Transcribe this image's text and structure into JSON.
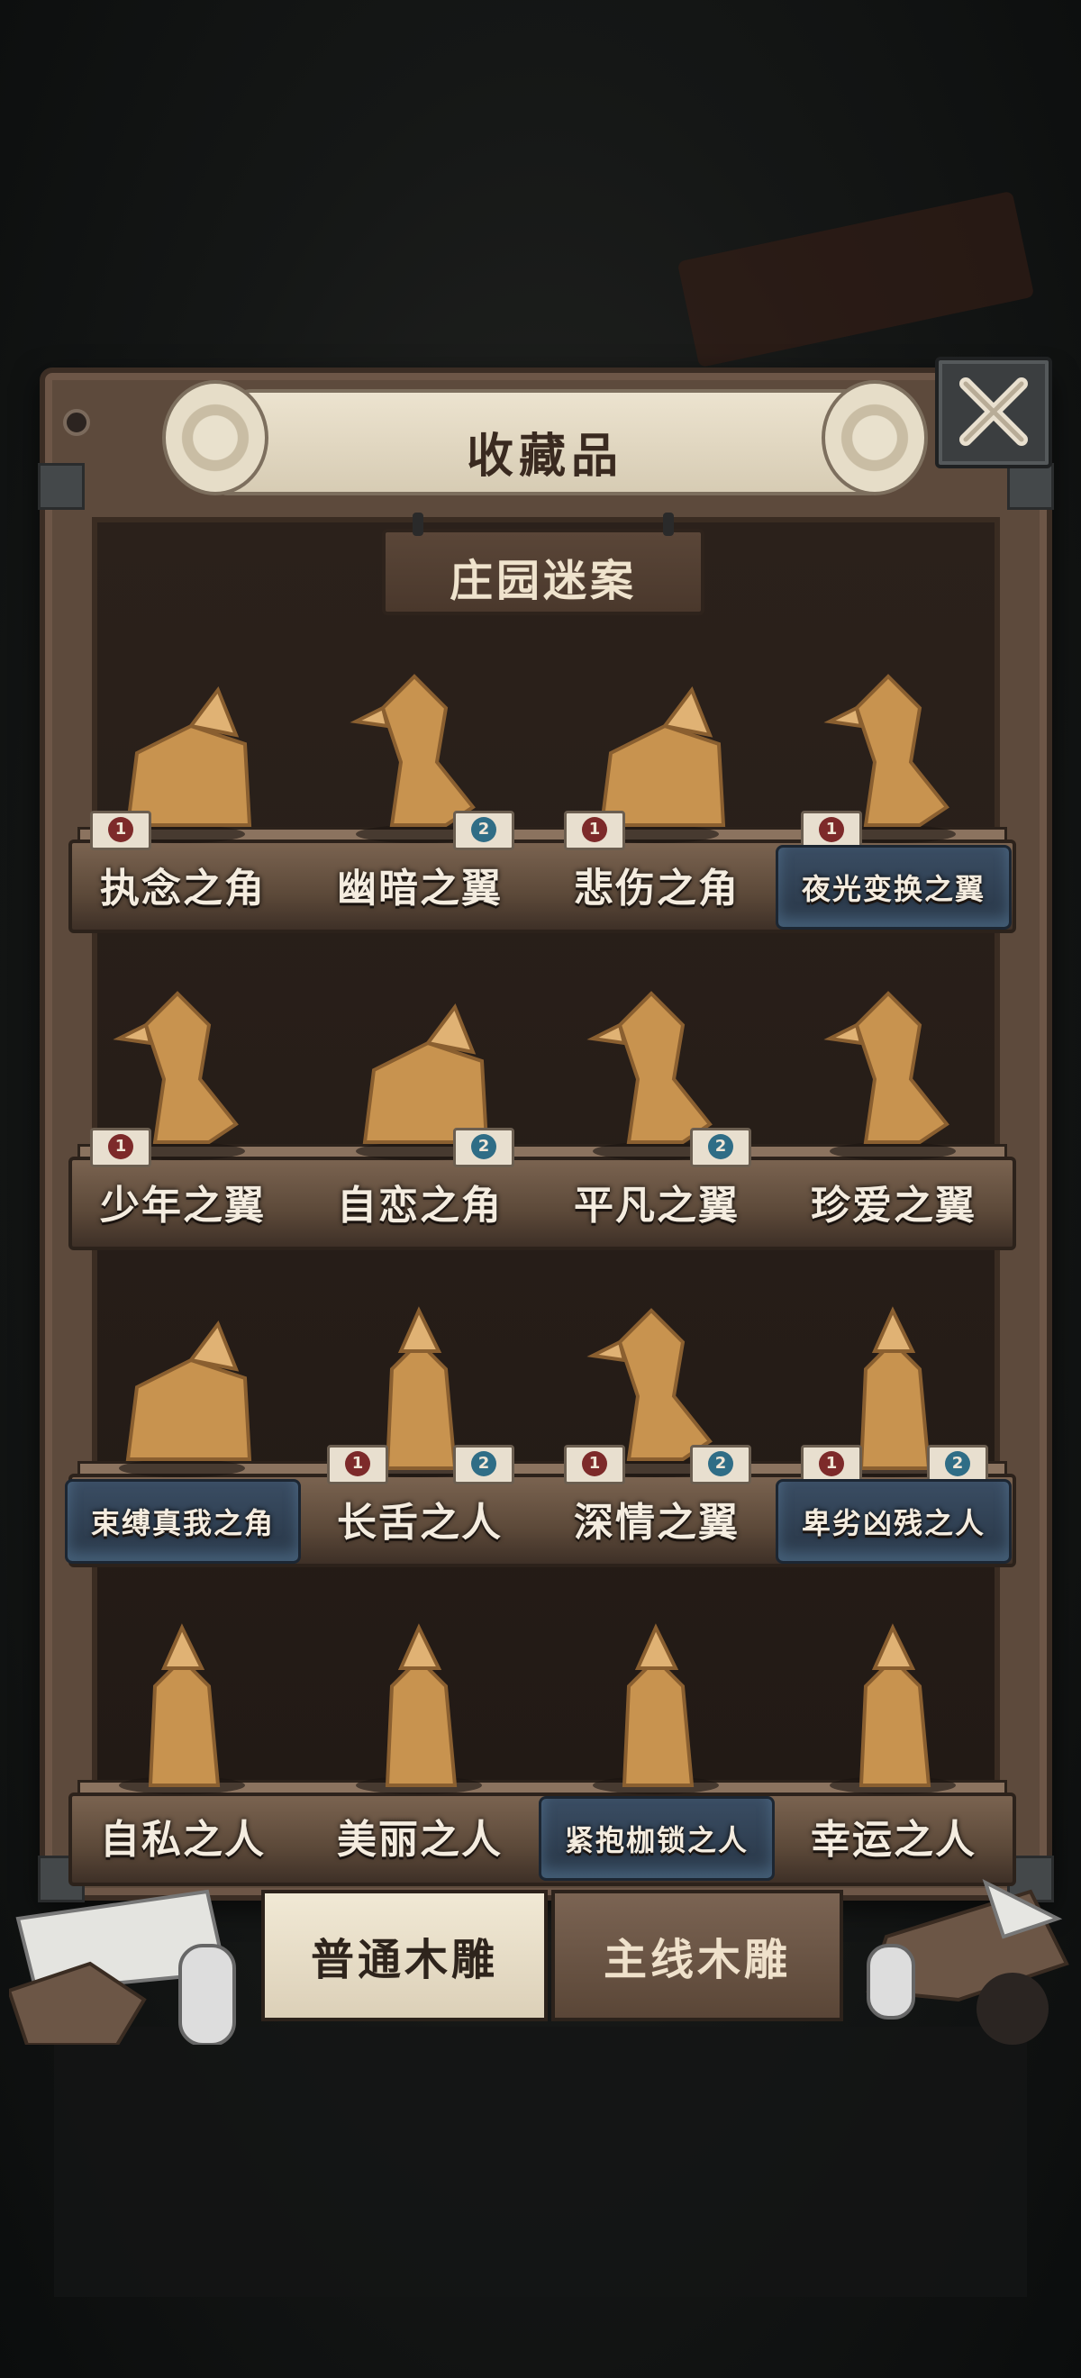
{
  "header": {
    "title": "收藏品",
    "close_icon": "close-x-icon"
  },
  "category": {
    "label": "庄园迷案"
  },
  "shelves": [
    {
      "items": [
        {
          "name": "执念之角",
          "figure": "elephant-carving",
          "plate": "wood",
          "badges": [
            {
              "text": "1",
              "color": "red"
            }
          ]
        },
        {
          "name": "幽暗之翼",
          "figure": "heron-carving",
          "plate": "wood",
          "badges": [
            {
              "text": "2",
              "color": "blue"
            }
          ]
        },
        {
          "name": "悲伤之角",
          "figure": "fox-carving",
          "plate": "wood",
          "badges": [
            {
              "text": "1",
              "color": "red"
            }
          ]
        },
        {
          "name": "夜光变换之翼",
          "figure": "owl-lamp-carving",
          "plate": "blue",
          "badges": [
            {
              "text": "1",
              "color": "red"
            }
          ]
        }
      ]
    },
    {
      "items": [
        {
          "name": "少年之翼",
          "figure": "rooster-carving",
          "plate": "wood",
          "badges": [
            {
              "text": "1",
              "color": "red"
            }
          ]
        },
        {
          "name": "自恋之角",
          "figure": "goat-carving",
          "plate": "wood",
          "badges": [
            {
              "text": "2",
              "color": "blue"
            }
          ]
        },
        {
          "name": "平凡之翼",
          "figure": "bird-carving",
          "plate": "wood",
          "badges": [
            {
              "text": "2",
              "color": "blue"
            }
          ]
        },
        {
          "name": "珍爱之翼",
          "figure": "peacock-carving",
          "plate": "wood",
          "badges": []
        }
      ]
    },
    {
      "items": [
        {
          "name": "束缚真我之角",
          "figure": "horned-dog-carving",
          "plate": "blue",
          "badges": []
        },
        {
          "name": "长舌之人",
          "figure": "top-hat-man-carving",
          "plate": "wood",
          "badges": [
            {
              "text": "1",
              "color": "red"
            },
            {
              "text": "2",
              "color": "blue"
            }
          ]
        },
        {
          "name": "深情之翼",
          "figure": "crow-carving",
          "plate": "wood",
          "badges": [
            {
              "text": "1",
              "color": "red"
            },
            {
              "text": "2",
              "color": "blue"
            }
          ]
        },
        {
          "name": "卑劣凶残之人",
          "figure": "cloaked-man-carving",
          "plate": "blue",
          "badges": [
            {
              "text": "1",
              "color": "red"
            },
            {
              "text": "2",
              "color": "blue"
            }
          ]
        }
      ]
    },
    {
      "items": [
        {
          "name": "自私之人",
          "figure": "hunched-man-carving",
          "plate": "wood",
          "badges": []
        },
        {
          "name": "美丽之人",
          "figure": "veiled-woman-carving",
          "plate": "wood",
          "badges": []
        },
        {
          "name": "紧抱枷锁之人",
          "figure": "chained-man-carving",
          "plate": "blue",
          "badges": []
        },
        {
          "name": "幸运之人",
          "figure": "stout-man-carving",
          "plate": "wood",
          "badges": []
        }
      ]
    }
  ],
  "tabs": [
    {
      "label": "普通木雕",
      "active": true
    },
    {
      "label": "主线木雕",
      "active": false
    }
  ],
  "colors": {
    "wood": "#5d4a3c",
    "carving": "#c8934f",
    "plate_blue": "#2f4257",
    "badge_red": "#7d2a2a",
    "badge_blue": "#2f6d86"
  }
}
